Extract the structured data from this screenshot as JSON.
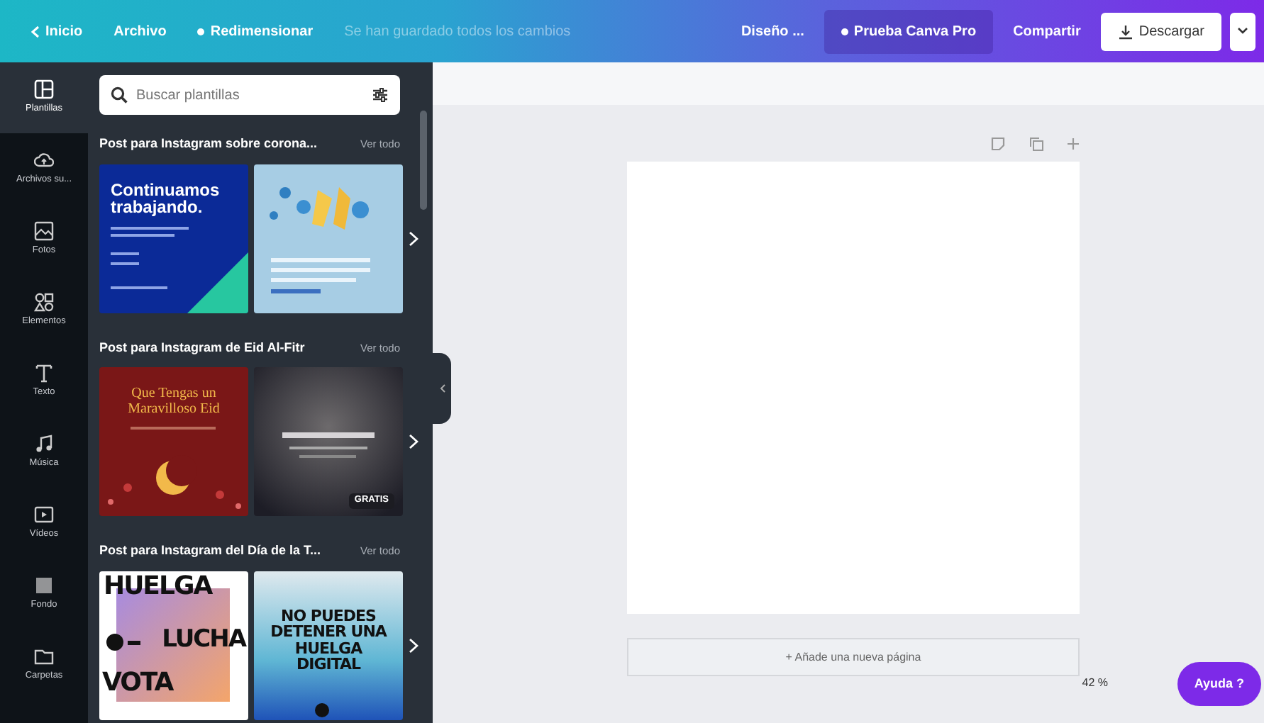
{
  "top_bar": {
    "left": [
      {
        "label": "Inicio",
        "kind": "back"
      },
      {
        "label": "Archivo",
        "kind": "link"
      },
      {
        "label": "Redimensionar",
        "kind": "dot"
      },
      {
        "label": "Se han guardado todos los cambios",
        "kind": "status"
      }
    ],
    "right": [
      {
        "label": "Diseño ...",
        "kind": "link"
      },
      {
        "label": "Prueba Canva Pro",
        "kind": "pro"
      },
      {
        "label": "Compartir",
        "kind": "link"
      },
      {
        "label": "Descargar",
        "kind": "download"
      }
    ]
  },
  "sidebar": {
    "items": [
      {
        "label": "Plantillas",
        "selected": true
      },
      {
        "label": "Archivos su...",
        "selected": false
      },
      {
        "label": "Fotos",
        "selected": false
      },
      {
        "label": "Elementos",
        "selected": false
      },
      {
        "label": "Texto",
        "selected": false
      },
      {
        "label": "Música",
        "selected": false
      },
      {
        "label": "Vídeos",
        "selected": false
      },
      {
        "label": "Fondo",
        "selected": false
      },
      {
        "label": "Carpetas",
        "selected": false
      }
    ]
  },
  "panel": {
    "search": {
      "placeholder": "Buscar plantillas"
    },
    "sections": [
      {
        "title": "Post para Instagram sobre corona...",
        "link": "Ver todo",
        "thumbs": [
          {
            "kind": "navy",
            "words": [
              "Continuamos trabajando."
            ]
          },
          {
            "kind": "sky"
          }
        ]
      },
      {
        "title": "Post para Instagram de Eid Al-Fitr",
        "link": "Ver todo",
        "thumbs": [
          {
            "kind": "maroon",
            "words": [
              "Que Tengas un Maravilloso Eid"
            ]
          },
          {
            "kind": "night",
            "badge": "GRATIS"
          }
        ]
      },
      {
        "title": "Post para Instagram del Día de la T...",
        "link": "Ver todo",
        "thumbs": [
          {
            "kind": "strike",
            "words": [
              "HUELGA",
              "LUCHA",
              "VOTA"
            ]
          },
          {
            "kind": "haze",
            "words": [
              "NO PUEDES DETENER UNA HUELGA DIGITAL"
            ]
          }
        ]
      }
    ]
  },
  "canvas": {
    "add_page": "+ Añade una nueva página",
    "zoom": "42 %",
    "help": {
      "label": "Ayuda",
      "icon": "?"
    }
  }
}
